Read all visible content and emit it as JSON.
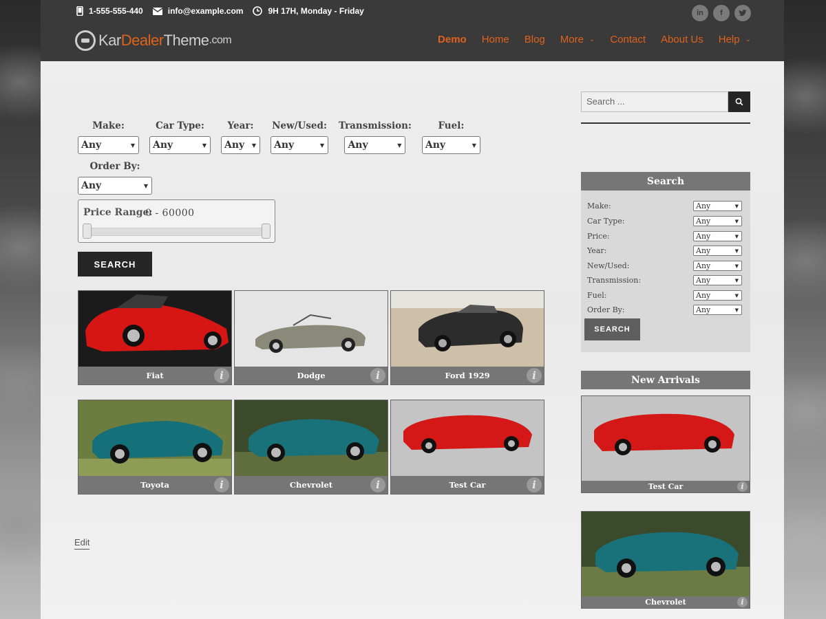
{
  "topbar": {
    "phone": "1-555-555-440",
    "email": "info@example.com",
    "hours": "9H 17H, Monday - Friday"
  },
  "social": [
    "linkedin-icon",
    "facebook-icon",
    "twitter-icon"
  ],
  "logo": {
    "part1": "Kar",
    "part2": "Dealer",
    "part3": "Theme",
    "part4": ".com"
  },
  "nav": [
    {
      "label": "Demo"
    },
    {
      "label": "Home"
    },
    {
      "label": "Blog"
    },
    {
      "label": "More",
      "has_dropdown": true
    },
    {
      "label": "Contact"
    },
    {
      "label": "About Us"
    },
    {
      "label": "Help",
      "has_dropdown": true
    }
  ],
  "filters": {
    "make": {
      "label": "Make:",
      "value": "Any"
    },
    "car_type": {
      "label": "Car Type:",
      "value": "Any"
    },
    "year": {
      "label": "Year:",
      "value": "Any"
    },
    "new_used": {
      "label": "New/Used:",
      "value": "Any"
    },
    "transmission": {
      "label": "Transmission:",
      "value": "Any"
    },
    "fuel": {
      "label": "Fuel:",
      "value": "Any"
    },
    "order_by": {
      "label": "Order By:",
      "value": "Any"
    },
    "price_range": {
      "label": "Price Range:",
      "value": "0 - 60000"
    },
    "search_label": "SEARCH"
  },
  "cars": [
    {
      "name": "Fiat"
    },
    {
      "name": "Dodge"
    },
    {
      "name": "Ford 1929"
    },
    {
      "name": "Toyota"
    },
    {
      "name": "Chevrolet"
    },
    {
      "name": "Test Car"
    }
  ],
  "edit_label": "Edit",
  "sidebar": {
    "search_placeholder": "Search ...",
    "search_widget": {
      "title": "Search",
      "rows": [
        {
          "label": "Make:",
          "value": "Any"
        },
        {
          "label": "Car Type:",
          "value": "Any"
        },
        {
          "label": "Price:",
          "value": "Any"
        },
        {
          "label": "Year:",
          "value": "Any"
        },
        {
          "label": "New/Used:",
          "value": "Any"
        },
        {
          "label": "Transmission:",
          "value": "Any"
        },
        {
          "label": "Fuel:",
          "value": "Any"
        },
        {
          "label": "Order By:",
          "value": "Any"
        }
      ],
      "button": "SEARCH"
    },
    "new_arrivals": {
      "title": "New Arrivals",
      "items": [
        {
          "name": "Test Car"
        },
        {
          "name": "Chevrolet"
        }
      ]
    }
  },
  "colors": {
    "accent": "#e0621b",
    "header_bg": "#3a3a3a",
    "caption_bg": "#767676"
  }
}
